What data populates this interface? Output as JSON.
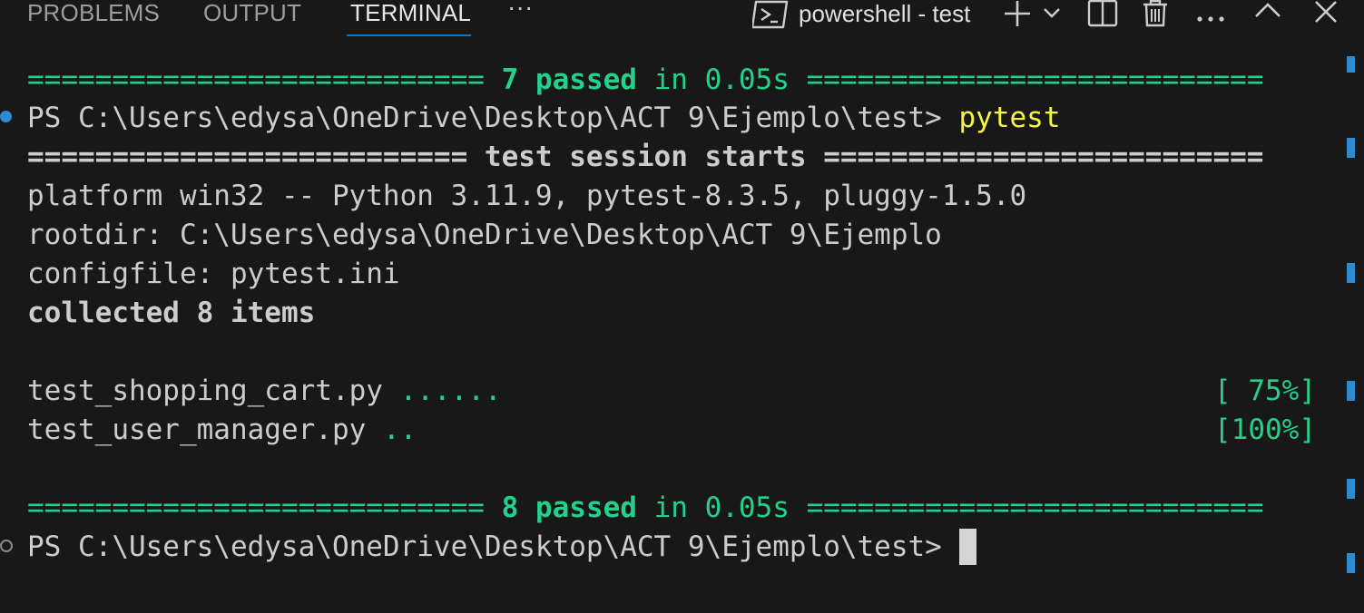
{
  "tabs": [
    {
      "label": "PROBLEMS"
    },
    {
      "label": "OUTPUT"
    },
    {
      "label": "TERMINAL"
    }
  ],
  "tab_overflow": "···",
  "terminal_selector": {
    "name": "powershell - test",
    "icon": "terminal-icon"
  },
  "toolbar_icons": [
    "plus-icon",
    "chevron-down-icon",
    "split-icon",
    "trash-icon",
    "more-icon",
    "chevron-up-icon",
    "close-icon"
  ],
  "terminal": {
    "sep_top_left": "===========================",
    "sep_top_mid_count": "7 passed",
    "sep_top_mid_time": "in 0.05s",
    "sep_top_right": "===========================",
    "prompt_1": "PS C:\\Users\\edysa\\OneDrive\\Desktop\\ACT 9\\Ejemplo\\test> ",
    "command_1": "pytest",
    "session_line": "========================== test session starts ==========================",
    "platform": "platform win32 -- Python 3.11.9, pytest-8.3.5, pluggy-1.5.0",
    "rootdir": "rootdir: C:\\Users\\edysa\\OneDrive\\Desktop\\ACT 9\\Ejemplo",
    "configfile": "configfile: pytest.ini",
    "collected": "collected 8 items",
    "test1_file": "test_shopping_cart.py ",
    "test1_dots": "......",
    "test1_pct": "[ 75%]",
    "test2_file": "test_user_manager.py ",
    "test2_dots": "..",
    "test2_pct": "[100%]",
    "sep_bot_left": "===========================",
    "sep_bot_mid_count": "8 passed",
    "sep_bot_mid_time": "in 0.05s",
    "sep_bot_right": "===========================",
    "prompt_2": "PS C:\\Users\\edysa\\OneDrive\\Desktop\\ACT 9\\Ejemplo\\test> "
  },
  "colors": {
    "background": "#181818",
    "success": "#23d18b",
    "command": "#f5f543",
    "accent": "#0078d4",
    "marker_success": "#2e8bd0"
  }
}
